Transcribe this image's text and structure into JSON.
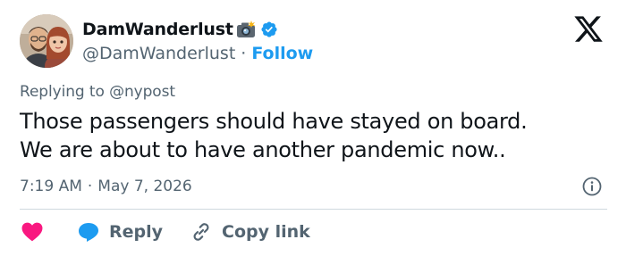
{
  "user": {
    "display_name": "DamWanderlust",
    "handle": "@DamWanderlust",
    "separator": "·",
    "follow_label": "Follow",
    "name_emoji_icon": "camera-flash-icon",
    "verified_icon": "verified-badge-icon"
  },
  "reply_context": {
    "prefix": "Replying to",
    "user": "@nypost"
  },
  "tweet": {
    "lines": [
      "Those passengers should have stayed on board.",
      "We are about to have another pandemic now.."
    ],
    "time": "7:19 AM",
    "dot": "·",
    "date": "May 7, 2026"
  },
  "actions": {
    "like_icon": "heart-icon",
    "reply_label": "Reply",
    "copy_label": "Copy link"
  },
  "colors": {
    "accent": "#1d9bf0",
    "like": "#f91880",
    "text": "#0f1419",
    "secondary": "#536471",
    "divider": "#cfd9de"
  }
}
